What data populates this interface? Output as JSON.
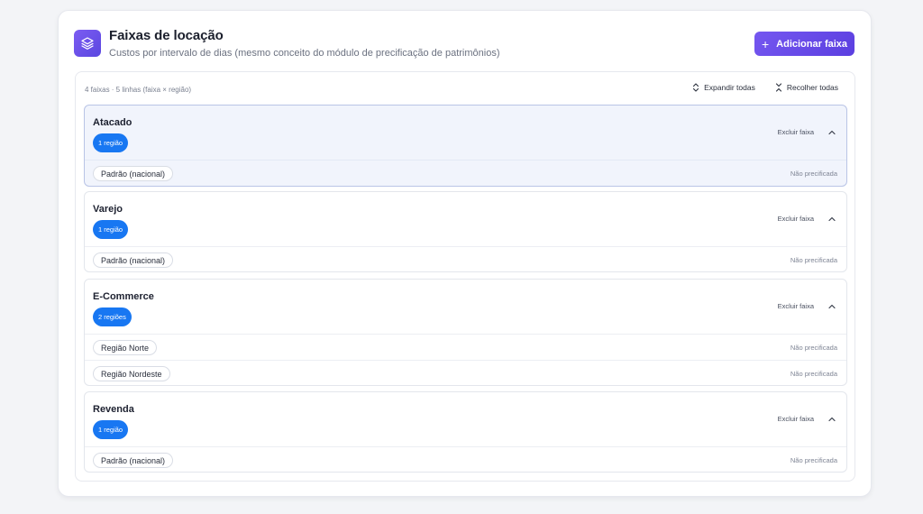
{
  "header": {
    "icon": "layers-icon",
    "title": "Faixas de locação",
    "subtitle": "Custos por intervalo de dias (mesmo conceito do módulo de precificação de patrimônios)",
    "add_button": "Adicionar faixa"
  },
  "toolbar": {
    "summary": "4 faixas · 5 linhas (faixa × região)",
    "expand_all": "Expandir todas",
    "collapse_all": "Recolher todas"
  },
  "groups": [
    {
      "name": "Atacado",
      "badge": "1 região",
      "delete_label": "Excluir faixa",
      "active": true,
      "regions": [
        {
          "label": "Padrão (nacional)",
          "status": "Não precificada"
        }
      ]
    },
    {
      "name": "Varejo",
      "badge": "1 região",
      "delete_label": "Excluir faixa",
      "active": false,
      "regions": [
        {
          "label": "Padrão (nacional)",
          "status": "Não precificada"
        }
      ]
    },
    {
      "name": "E-Commerce",
      "badge": "2 regiões",
      "delete_label": "Excluir faixa",
      "active": false,
      "regions": [
        {
          "label": "Região Norte",
          "status": "Não precificada"
        },
        {
          "label": "Região Nordeste",
          "status": "Não precificada"
        }
      ]
    },
    {
      "name": "Revenda",
      "badge": "1 região",
      "delete_label": "Excluir faixa",
      "active": false,
      "regions": [
        {
          "label": "Padrão (nacional)",
          "status": "Não precificada"
        }
      ]
    }
  ],
  "colors": {
    "accent": "#6a4ff0",
    "badge": "#1877f2",
    "active_group_bg": "#f1f4fc"
  }
}
